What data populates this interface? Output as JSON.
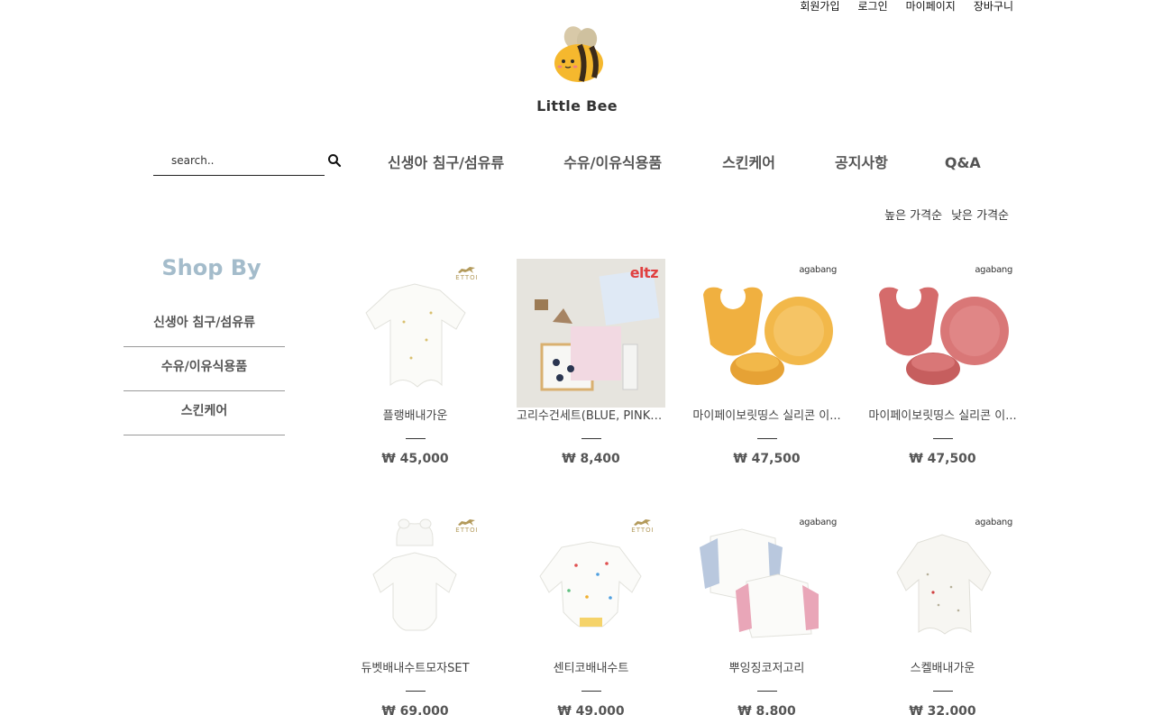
{
  "top_links": [
    "회원가입",
    "로그인",
    "마이페이지",
    "장바구니"
  ],
  "logo": {
    "text": "Little Bee"
  },
  "search": {
    "placeholder": "search.."
  },
  "gnb": [
    "신생아 침구/섬유류",
    "수유/이유식용품",
    "스킨케어",
    "공지사항",
    "Q&A"
  ],
  "sort": [
    "높은 가격순",
    "낮은 가격순"
  ],
  "sidebar": {
    "title": "Shop By",
    "items": [
      "신생아 침구/섬유류",
      "수유/이유식용품",
      "스킨케어"
    ]
  },
  "products": [
    {
      "name": "플랭배내가운",
      "price": "₩ 45,000",
      "brand": "ETTOI"
    },
    {
      "name": "고리수건세트(BLUE, PINK, ...",
      "price": "₩ 8,400",
      "brand": "eltz"
    },
    {
      "name": "마이페이보릿띵스 실리콘 이...",
      "price": "₩ 47,500",
      "brand": "agabang"
    },
    {
      "name": "마이페이보릿띵스 실리콘 이...",
      "price": "₩ 47,500",
      "brand": "agabang"
    },
    {
      "name": "듀벳배내수트모자SET",
      "price": "₩ 69,000",
      "brand": "ETTOI"
    },
    {
      "name": "센티코배내수트",
      "price": "₩ 49,000",
      "brand": "ETTOI"
    },
    {
      "name": "뿌잉징코저고리",
      "price": "₩ 8,800",
      "brand": "agabang"
    },
    {
      "name": "스켈배내가운",
      "price": "₩ 32,000",
      "brand": "agabang"
    }
  ],
  "colors": {
    "accent_shopby": "#a4bccb",
    "bee_yellow": "#f5b82e",
    "bib_yellow": "#f0b040",
    "bib_pink": "#d56b6b"
  }
}
